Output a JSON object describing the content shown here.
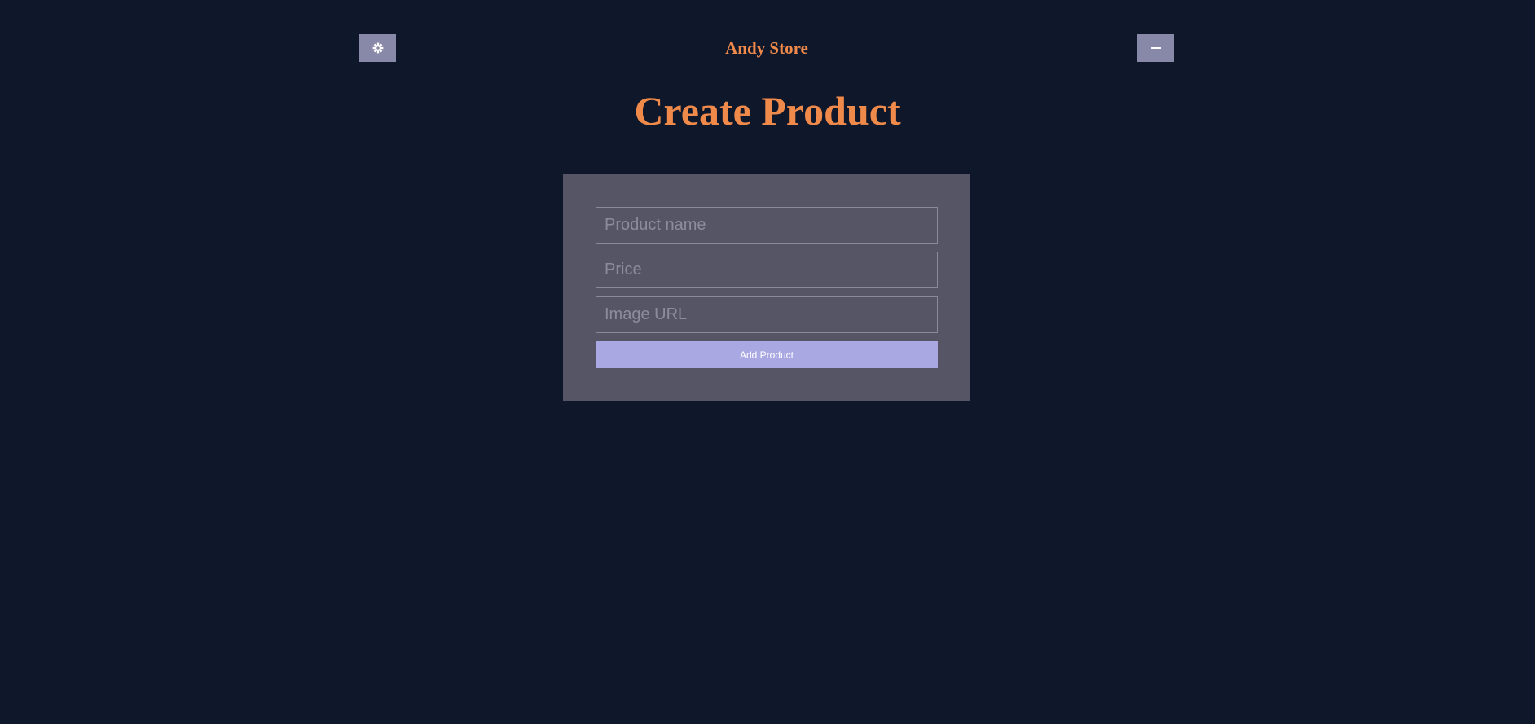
{
  "header": {
    "store_name": "Andy Store",
    "settings_icon": "gear-icon",
    "minimize_icon": "dash-icon"
  },
  "page": {
    "title": "Create Product"
  },
  "form": {
    "product_name": {
      "placeholder": "Product name",
      "value": ""
    },
    "price": {
      "placeholder": "Price",
      "value": ""
    },
    "image_url": {
      "placeholder": "Image URL",
      "value": ""
    },
    "submit_label": "Add Product"
  },
  "colors": {
    "background": "#0f172a",
    "accent": "#f08a4b",
    "card": "#565566",
    "icon_button": "#8888a8",
    "submit_button": "#aaa8e2"
  }
}
